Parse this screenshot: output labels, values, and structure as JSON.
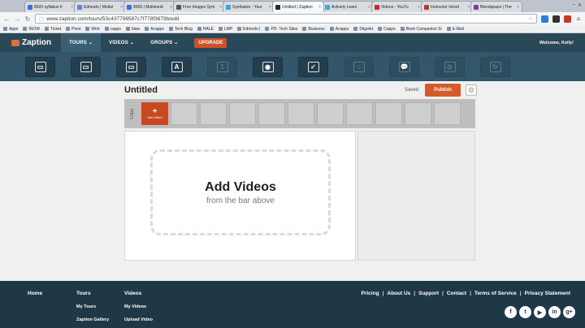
{
  "browser": {
    "tabs": [
      {
        "label": "8505 syllabus fr",
        "color": "#3b6fd8",
        "active": false
      },
      {
        "label": "Edmodo | Modul",
        "color": "#5c87c9",
        "active": false
      },
      {
        "label": "8505 | Multimedi",
        "color": "#3b6fd8",
        "active": false
      },
      {
        "label": "Free Images Sym",
        "color": "#555555",
        "active": false
      },
      {
        "label": "Symbaloo - Your",
        "color": "#3aa6e0",
        "active": false
      },
      {
        "label": "Untitled | Zaption",
        "color": "#2b2b2b",
        "active": true
      },
      {
        "label": "Actively Learn",
        "color": "#4aa3c9",
        "active": false
      },
      {
        "label": "Videos - YouTu",
        "color": "#d32a1f",
        "active": false
      },
      {
        "label": "Instructor Introd",
        "color": "#b53a2a",
        "active": false
      },
      {
        "label": "Blendspace | The",
        "color": "#7a3fa0",
        "active": false
      }
    ],
    "url": "www.zaption.com/tours/53c437798587c7f778f3679b/edit",
    "bookmarks": [
      "Apps",
      "INOW",
      "Ticket",
      "Pivot",
      "Web",
      "capps",
      "blaw",
      "Acapps",
      "Tech Blog",
      "HALE",
      "LMP",
      "Edmodo |",
      "PD- Tech Sites",
      "Business",
      "Acapps",
      "Diigolet",
      "Capps",
      "Book Companion Si",
      "E-Mail"
    ]
  },
  "topnav": {
    "logo": "Zaption",
    "items": [
      "TOURS ⌄",
      "VIDEOS ⌄",
      "GROUPS ⌄"
    ],
    "upgrade": "UPGRADE",
    "welcome": "Welcome, Kelly!"
  },
  "toolbar": {
    "tools": [
      {
        "name": "image-slide-icon",
        "glyph": "▭",
        "enabled": true
      },
      {
        "name": "image-gallery-icon",
        "glyph": "▭",
        "enabled": true
      },
      {
        "name": "image-slide-alt-icon",
        "glyph": "▭",
        "enabled": true
      },
      {
        "name": "text-slide-icon",
        "glyph": "A",
        "enabled": true
      },
      {
        "name": "numbered-slide-icon",
        "glyph": "1",
        "enabled": false
      },
      {
        "name": "multiple-choice-icon",
        "glyph": "◉",
        "enabled": true
      },
      {
        "name": "checkbox-question-icon",
        "glyph": "✓",
        "enabled": true
      },
      {
        "name": "drawing-question-icon",
        "glyph": "☺",
        "enabled": false
      },
      {
        "name": "discussion-icon",
        "glyph": "💬",
        "enabled": false
      },
      {
        "name": "jump-icon",
        "glyph": "◎",
        "enabled": false
      },
      {
        "name": "loop-icon",
        "glyph": "↻",
        "enabled": false
      }
    ]
  },
  "editor": {
    "title": "Untitled",
    "saved": "Saved",
    "publish": "Publish",
    "clips_label": "Clips",
    "add_video_label": "Add Video",
    "empty_slots": 10,
    "dropzone_title": "Add Videos",
    "dropzone_sub": "from the bar above"
  },
  "footer": {
    "col1": [
      "Home"
    ],
    "col2": [
      "Tours",
      "My Tours",
      "Zaption Gallery"
    ],
    "col3": [
      "Videos",
      "My Videos",
      "Upload Video"
    ],
    "links": [
      "Pricing",
      "About Us",
      "Support",
      "Contact",
      "Terms of Service",
      "Privacy Statement"
    ],
    "social": [
      "f",
      "t",
      "▶",
      "in",
      "g+"
    ]
  },
  "colors": {
    "nav_bg": "#2b4859",
    "toolbar_bg": "#34566a",
    "accent": "#d75a2b",
    "footer_bg": "#1f3847"
  }
}
